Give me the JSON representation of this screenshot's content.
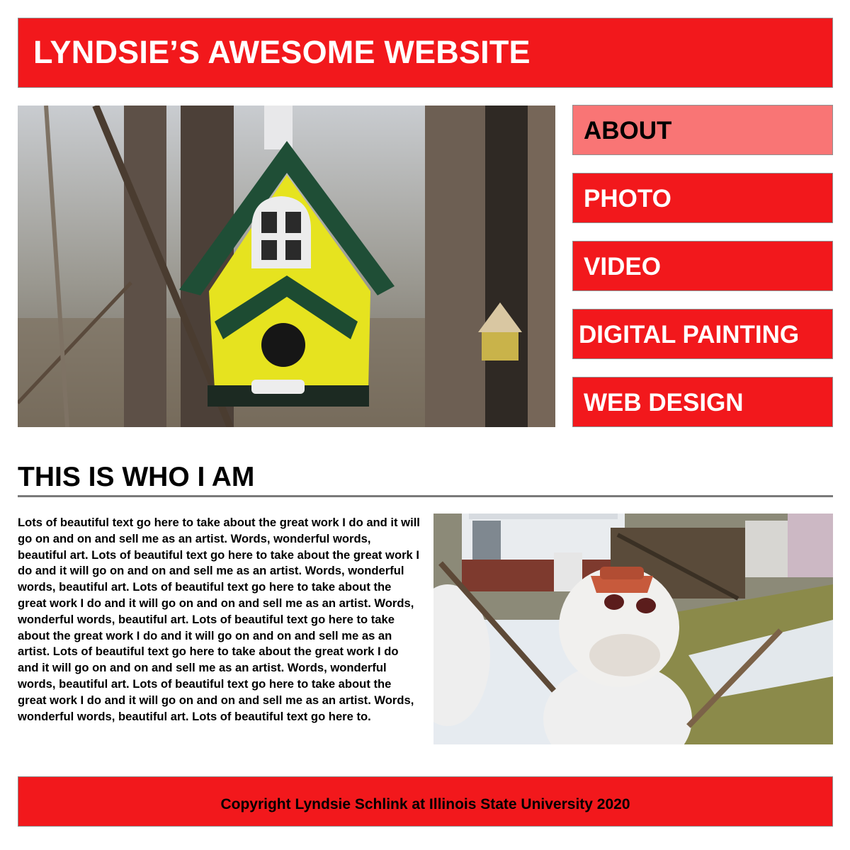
{
  "header": {
    "title": "LYNDSIE’S AWESOME WEBSITE"
  },
  "nav": {
    "items": [
      {
        "label": "ABOUT",
        "active": true
      },
      {
        "label": "PHOTO",
        "active": false
      },
      {
        "label": "VIDEO",
        "active": false
      },
      {
        "label": "DIGITAL PAINTING",
        "active": false
      },
      {
        "label": "WEB DESIGN",
        "active": false
      }
    ]
  },
  "about": {
    "title": "THIS IS WHO I AM",
    "body": "Lots of beautiful text go here to take about the great work I do and it will go on and on and sell me as an artist. Words, wonderful words, beautiful art. Lots of beautiful text go here to take about the great work I do and it will go on and on and sell me as an artist. Words, wonderful words, beautiful art. Lots of beautiful text go here to take about the great work I do and it will go on and on and sell me as an artist. Words, wonderful words, beautiful art. Lots of beautiful text go here to take about the great work I do and it will go on and on and sell me as an artist. Lots of beautiful text go here to take about the great work I do and it will go on and on and sell me as an artist. Words, wonderful words, beautiful art. Lots of beautiful text go here to take about the great work I do and it will go on and on and sell me as an artist. Words, wonderful words, beautiful art. Lots of beautiful text go here to."
  },
  "footer": {
    "copyright": "Copyright Lyndsie Schlink at Illinois State University 2020"
  },
  "colors": {
    "brand_red": "#f2181c",
    "active_nav": "#f97575",
    "border": "#8f8f8f",
    "rule": "#7a7a7a"
  },
  "images": {
    "hero": "birdhouse-photo",
    "side": "snowman-photo"
  }
}
